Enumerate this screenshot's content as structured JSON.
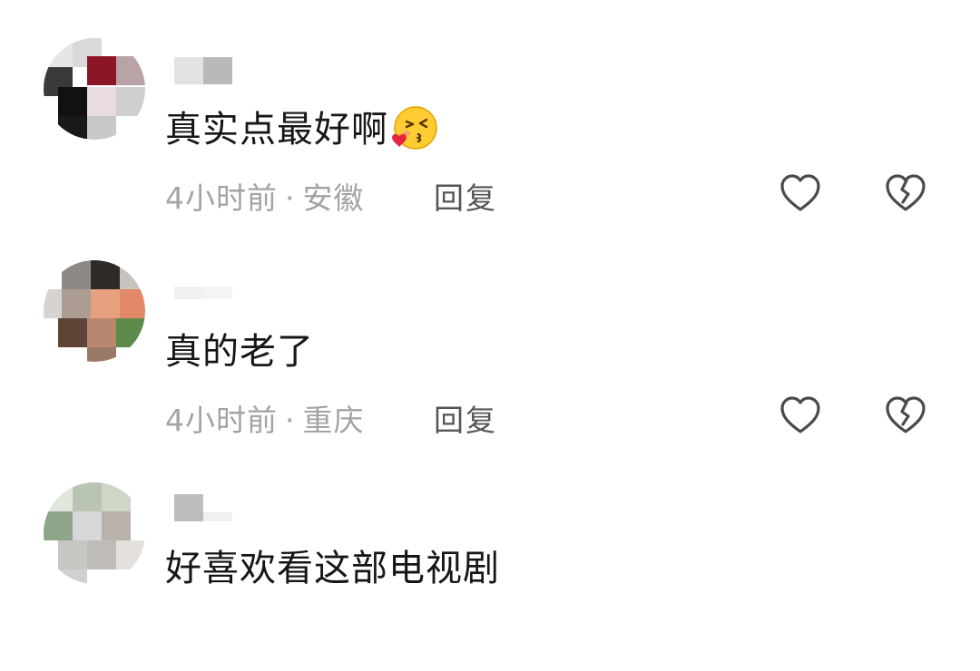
{
  "comments": [
    {
      "text": "真实点最好啊",
      "time": "4小时前",
      "separator": "·",
      "location": "安徽",
      "reply_label": "回复",
      "emoji": "kissing-heart-emoji"
    },
    {
      "text": "真的老了",
      "time": "4小时前",
      "separator": "·",
      "location": "重庆",
      "reply_label": "回复"
    },
    {
      "text": "好喜欢看这部电视剧"
    }
  ],
  "icons": {
    "like": "heart-outline-icon",
    "dislike": "broken-heart-icon"
  },
  "colors": {
    "text": "#161616",
    "meta": "#a3a3a3",
    "reply": "#555555",
    "icon": "#4a4a4a"
  }
}
